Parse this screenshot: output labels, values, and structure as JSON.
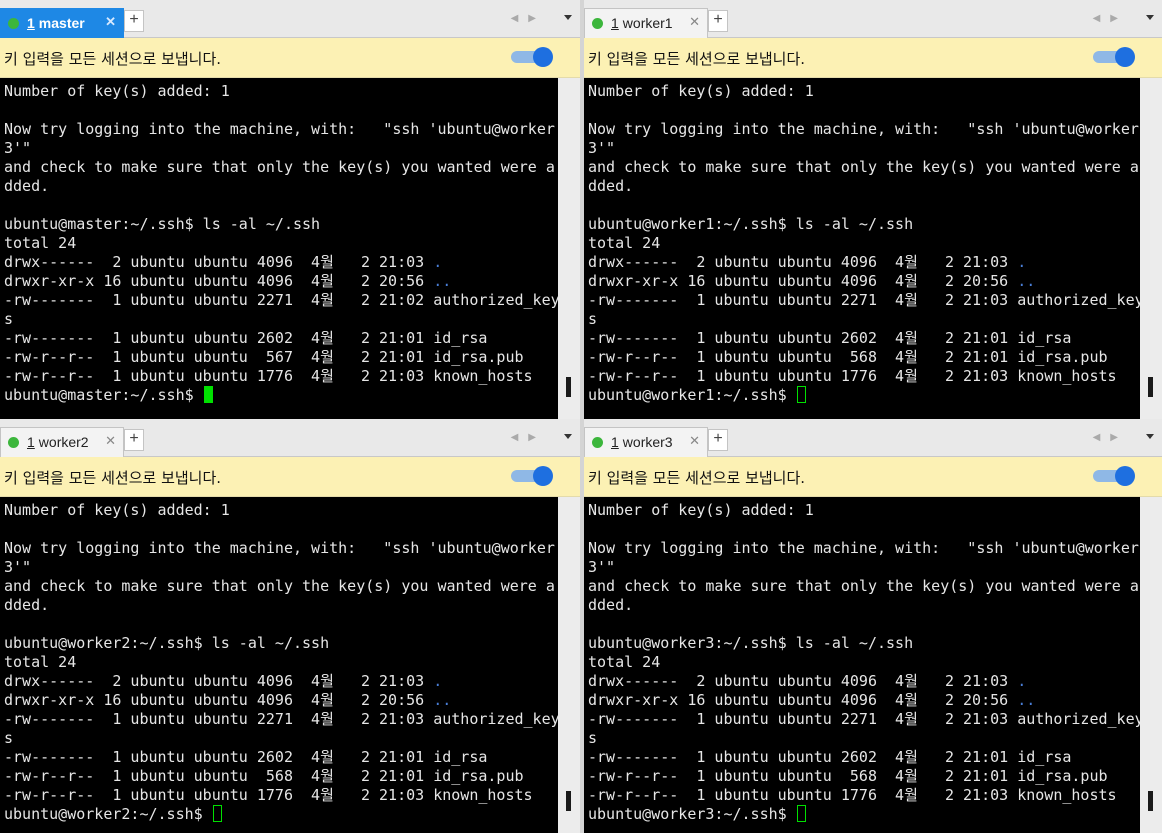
{
  "banner_text": "키 입력을 모든 세션으로 보냅니다.",
  "ls_cmd": "$ ls -al ~/.ssh",
  "common": {
    "l1": "Number of key(s) added: 1",
    "l2": "",
    "l3": "Now try logging into the machine, with:   \"ssh 'ubuntu@worker",
    "l4": "3'\"",
    "l5": "and check to make sure that only the key(s) you wanted were a",
    "l6": "dded.",
    "l7": "",
    "total": "total 24",
    "cur_dir_prefix": "drwx------  2 ubuntu ubuntu 4096  4월   2 21:03 ",
    "cur_dir_name": ".",
    "par_dir_prefix": "drwxr-xr-x 16 ubuntu ubuntu 4096  4월   2 20:56 ",
    "par_dir_name": ".."
  },
  "panes": [
    {
      "tab_num": "1",
      "tab_name": "master",
      "prompt": "ubuntu@master:~/.ssh",
      "auth": "-rw-------  1 ubuntu ubuntu 2271  4월   2 21:02 authorized_key",
      "auth_wrap": "s",
      "idrsa": "-rw-------  1 ubuntu ubuntu 2602  4월   2 21:01 id_rsa",
      "idpub": "-rw-r--r--  1 ubuntu ubuntu  567  4월   2 21:01 id_rsa.pub",
      "known": "-rw-r--r--  1 ubuntu ubuntu 1776  4월   2 21:03 known_hosts",
      "final_prompt": "ubuntu@master:~/.ssh$ "
    },
    {
      "tab_num": "1",
      "tab_name": "worker1",
      "prompt": "ubuntu@worker1:~/.ssh",
      "auth": "-rw-------  1 ubuntu ubuntu 2271  4월   2 21:03 authorized_key",
      "auth_wrap": "s",
      "idrsa": "-rw-------  1 ubuntu ubuntu 2602  4월   2 21:01 id_rsa",
      "idpub": "-rw-r--r--  1 ubuntu ubuntu  568  4월   2 21:01 id_rsa.pub",
      "known": "-rw-r--r--  1 ubuntu ubuntu 1776  4월   2 21:03 known_hosts",
      "final_prompt": "ubuntu@worker1:~/.ssh$ "
    },
    {
      "tab_num": "1",
      "tab_name": "worker2",
      "prompt": "ubuntu@worker2:~/.ssh",
      "auth": "-rw-------  1 ubuntu ubuntu 2271  4월   2 21:03 authorized_key",
      "auth_wrap": "s",
      "idrsa": "-rw-------  1 ubuntu ubuntu 2602  4월   2 21:01 id_rsa",
      "idpub": "-rw-r--r--  1 ubuntu ubuntu  568  4월   2 21:01 id_rsa.pub",
      "known": "-rw-r--r--  1 ubuntu ubuntu 1776  4월   2 21:03 known_hosts",
      "final_prompt": "ubuntu@worker2:~/.ssh$ "
    },
    {
      "tab_num": "1",
      "tab_name": "worker3",
      "prompt": "ubuntu@worker3:~/.ssh",
      "auth": "-rw-------  1 ubuntu ubuntu 2271  4월   2 21:03 authorized_key",
      "auth_wrap": "s",
      "idrsa": "-rw-------  1 ubuntu ubuntu 2602  4월   2 21:01 id_rsa",
      "idpub": "-rw-r--r--  1 ubuntu ubuntu  568  4월   2 21:01 id_rsa.pub",
      "known": "-rw-r--r--  1 ubuntu ubuntu 1776  4월   2 21:03 known_hosts",
      "final_prompt": "ubuntu@worker3:~/.ssh$ "
    }
  ],
  "colors": {
    "active_tab": "#1e88e5",
    "session_dot": "#3cb63c",
    "banner_bg": "#fcf1b4",
    "cursor": "#00e000",
    "dir_name": "#4a7fd8"
  },
  "icons": {
    "close": "✕",
    "add": "+",
    "nav": "◀▶",
    "dropdown": "chevron-down"
  }
}
